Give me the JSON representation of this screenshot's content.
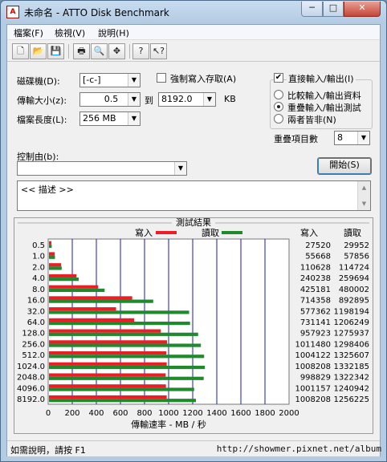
{
  "window": {
    "title": "未命名 - ATTO Disk Benchmark",
    "app_icon": "disk-benchmark-icon"
  },
  "caption_buttons": {
    "minimize": "─",
    "maximize": "□",
    "close": "✕"
  },
  "menu": [
    "檔案(F)",
    "檢視(V)",
    "說明(H)"
  ],
  "toolbar": [
    {
      "name": "new-icon",
      "glyph": "🗋"
    },
    {
      "name": "open-icon",
      "glyph": "📂"
    },
    {
      "name": "save-icon",
      "glyph": "💾"
    },
    {
      "name": "print-icon",
      "glyph": "🖶"
    },
    {
      "name": "print-preview-icon",
      "glyph": "🔍"
    },
    {
      "name": "move-icon",
      "glyph": "✥"
    },
    {
      "name": "help-icon",
      "glyph": "?"
    },
    {
      "name": "context-help-icon",
      "glyph": "↖?"
    }
  ],
  "settings": {
    "drive_label": "磁碟機(D):",
    "drive_value": "[-c-]",
    "transfer_label": "傳輸大小(z):",
    "transfer_from": "0.5",
    "transfer_to_label": "到",
    "transfer_to": "8192.0",
    "transfer_unit": "KB",
    "length_label": "檔案長度(L):",
    "length_value": "256 MB",
    "force_write_label": "強制寫入存取(A)",
    "direct_io_label": "直接輸入/輸出(I)",
    "direct_io_checked": "✔",
    "compare_label": "比較輸入/輸出資料",
    "overlap_label": "重疊輸入/輸出測試",
    "neither_label": "兩者皆非(N)",
    "queue_label": "重疊項目數",
    "queue_value": "8",
    "control_label": "控制由(b):",
    "control_value": "",
    "start_label": "開始(S)",
    "description": "<< 描述 >>"
  },
  "results": {
    "title": "測試結果",
    "write_legend": "寫入",
    "read_legend": "讀取",
    "col_write": "寫入",
    "col_read": "讀取",
    "write_color": "#ee1c24",
    "read_color": "#1e8a2c",
    "grid_color": "#1a1ab8"
  },
  "chart_data": {
    "type": "bar",
    "orientation": "horizontal",
    "title": "測試結果",
    "xlabel": "傳輸速率 - MB / 秒",
    "xlim": [
      0,
      2000
    ],
    "xticks": [
      "0",
      "200",
      "400",
      "600",
      "800",
      "1000",
      "1200",
      "1400",
      "1600",
      "1800",
      "2000"
    ],
    "categories": [
      "0.5",
      "1.0",
      "2.0",
      "4.0",
      "8.0",
      "16.0",
      "32.0",
      "64.0",
      "128.0",
      "256.0",
      "512.0",
      "1024.0",
      "2048.0",
      "4096.0",
      "8192.0"
    ],
    "series": [
      {
        "name": "寫入",
        "values": [
          26.9,
          54.4,
          108.0,
          234.6,
          415.5,
          697.6,
          563.8,
          714.0,
          935.5,
          987.4,
          980.6,
          984.4,
          975.6,
          977.7,
          984.4
        ]
      },
      {
        "name": "讀取",
        "values": [
          29.3,
          56.5,
          112.1,
          253.6,
          468.8,
          872.0,
          1170.1,
          1178.0,
          1245.0,
          1268.0,
          1294.8,
          1301.0,
          1291.4,
          1211.9,
          1226.8
        ]
      }
    ],
    "table_write": [
      "27520",
      "55668",
      "110628",
      "240238",
      "425181",
      "714358",
      "577362",
      "731141",
      "957923",
      "1011480",
      "1004122",
      "1008208",
      "998829",
      "1001157",
      "1008208"
    ],
    "table_read": [
      "29952",
      "57856",
      "114724",
      "259694",
      "480002",
      "892895",
      "1198194",
      "1206249",
      "1275937",
      "1298406",
      "1325607",
      "1332185",
      "1322342",
      "1240942",
      "1256225"
    ]
  },
  "status": {
    "text": "如需說明，請按 F1"
  },
  "watermark": "http://showmer.pixnet.net/album"
}
